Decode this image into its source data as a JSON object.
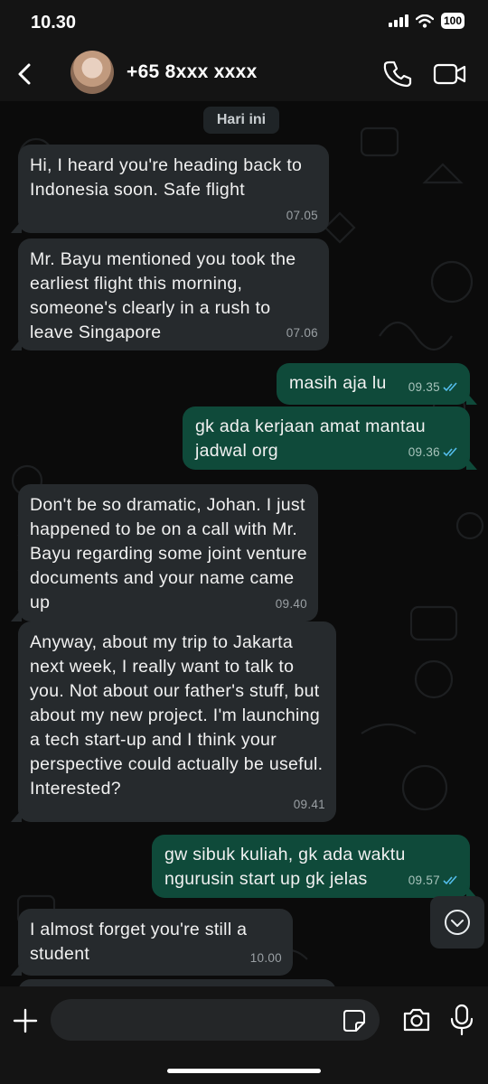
{
  "status_bar": {
    "time": "10.30",
    "battery": "100"
  },
  "header": {
    "contact_name": "+65 8xxx xxxx"
  },
  "chat": {
    "date_label": "Hari ini",
    "messages": [
      {
        "direction": "in",
        "text": "Hi, I heard you're heading back to Indonesia soon. Safe flight",
        "time": "07.05"
      },
      {
        "direction": "in",
        "text": "Mr. Bayu mentioned you took the earliest flight this morning, someone's clearly in a rush to leave Singapore",
        "time": "07.06"
      },
      {
        "direction": "out",
        "text": "masih aja lu",
        "time": "09.35",
        "read": true
      },
      {
        "direction": "out",
        "text": "gk ada kerjaan amat mantau jadwal org",
        "time": "09.36",
        "read": true
      },
      {
        "direction": "in",
        "text": "Don't be so dramatic, Johan. I just happened to be on a call with Mr. Bayu regarding some joint venture documents and your name came up",
        "time": "09.40"
      },
      {
        "direction": "in",
        "text": "Anyway, about my trip to Jakarta next week, I really want to talk to you. Not about our father's stuff, but about my new project. I'm launching a tech start-up and I think your perspective could actually be useful. Interested?",
        "time": "09.41"
      },
      {
        "direction": "out",
        "text": "gw sibuk kuliah, gk ada waktu ngurusin start up gk jelas",
        "time": "09.57",
        "read": true
      },
      {
        "direction": "in",
        "text": "I almost forget you're still a student",
        "time": "10.00"
      }
    ]
  },
  "input": {
    "value": ""
  },
  "colors": {
    "incoming_bubble": "#262a2d",
    "outgoing_bubble": "#0f4a3a",
    "read_ticks": "#53bdeb"
  }
}
